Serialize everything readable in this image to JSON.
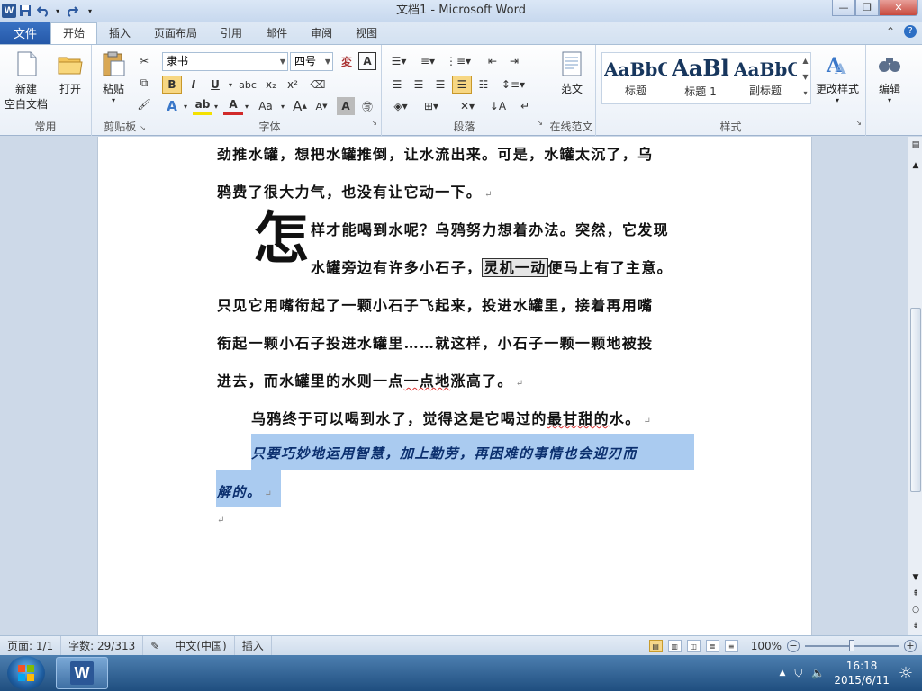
{
  "window": {
    "title": "文档1 - Microsoft Word"
  },
  "quick_access": {
    "save": "save-icon",
    "undo": "undo-icon",
    "redo": "redo-icon"
  },
  "tabs": {
    "file": "文件",
    "items": [
      "开始",
      "插入",
      "页面布局",
      "引用",
      "邮件",
      "审阅",
      "视图"
    ]
  },
  "ribbon": {
    "groups": {
      "common": "常用",
      "clipboard": "剪贴板",
      "font": "字体",
      "paragraph": "段落",
      "online_template": "在线范文",
      "styles": "样式"
    },
    "new_blank_line1": "新建",
    "new_blank_line2": "空白文档",
    "open": "打开",
    "paste": "粘贴",
    "font_name": "隶书",
    "font_size": "四号",
    "template": "范文",
    "change_styles": "更改样式",
    "edit": "编辑",
    "style_items": [
      {
        "sample": "AaBbC",
        "name": "标题"
      },
      {
        "sample": "AaBl",
        "name": "标题 1"
      },
      {
        "sample": "AaBbC",
        "name": "副标题"
      }
    ],
    "font_buttons": {
      "bold": "B",
      "italic": "I",
      "underline": "U",
      "strike": "abc",
      "sub": "x₂",
      "sup": "x²",
      "grow": "A",
      "shrink": "A",
      "case": "Aa",
      "char_border": "A"
    }
  },
  "document": {
    "line1": "劲推水罐，想把水罐推倒，让水流出来。可是，水罐太沉了，乌",
    "line2": "鸦费了很大力气，也没有让它动一下。",
    "dropcap": "怎",
    "line3": "样才能喝到水呢？乌鸦努力想着办法。突然，它发现",
    "line4a": "水罐旁边有许多小石子，",
    "line4box": "灵机一动",
    "line4b": "便马上有了主意。",
    "line5": "只见它用嘴衔起了一颗小石子飞起来，投进水罐里，接着再用嘴",
    "line6": "衔起一颗小石子投进水罐里……就这样，小石子一颗一颗地被投",
    "line7a": "进去，而水罐里的水则一点",
    "line7b": "一点地",
    "line7c": "涨高了。",
    "line8a": "乌鸦终于可以喝到水了，觉得这是它喝过的",
    "line8b": "最甘甜的",
    "line8c": "水。",
    "line9": "只要巧妙地运用智慧，加上勤劳，再困难的事情也会迎刃而",
    "line10": "解的。",
    "paragraph_mark": "↵"
  },
  "status": {
    "page": "页面: 1/1",
    "words": "字数: 29/313",
    "language": "中文(中国)",
    "mode": "插入",
    "zoom": "100%",
    "zoom_level": 1.0
  },
  "taskbar": {
    "time": "16:18",
    "date": "2015/6/11"
  },
  "colors": {
    "selection": "#aacbf0",
    "file_tab": "#2b5ea8",
    "title_bar": "#dbe7f6"
  }
}
